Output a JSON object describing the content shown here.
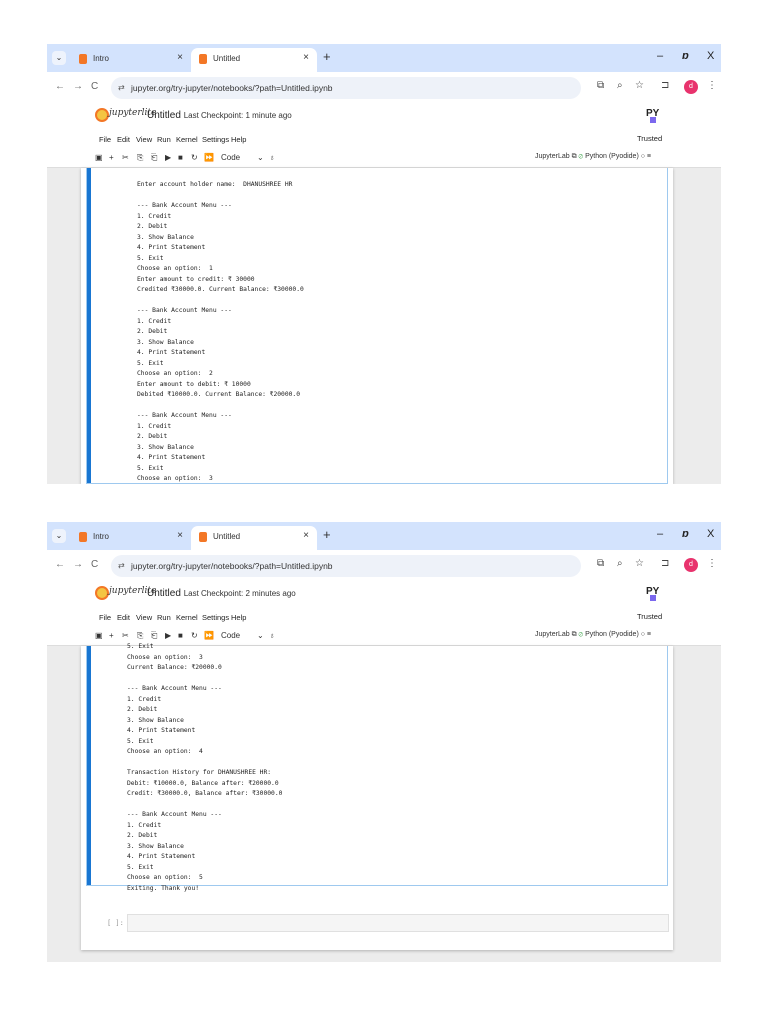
{
  "browser": {
    "tab_intro": "Intro",
    "tab_untitled": "Untitled",
    "url": "jupyter.org/try-jupyter/notebooks/?path=Untitled.ipynb",
    "avatar_letter": "d"
  },
  "jupyter": {
    "logo_text": "jupyterlite",
    "notebook_title": "Untitled",
    "checkpoint_1": "Last Checkpoint: 1 minute ago",
    "checkpoint_2": "Last Checkpoint: 2 minutes ago",
    "menu": [
      "File",
      "Edit",
      "View",
      "Run",
      "Kernel",
      "Settings",
      "Help"
    ],
    "trusted": "Trusted",
    "cell_type": "Code",
    "jupyterlab_link": "JupyterLab",
    "kernel_name": "Python (Pyodide)",
    "empty_prompt": "[ ]:"
  },
  "output_1": "Enter account holder name:  DHANUSHREE HR\n\n--- Bank Account Menu ---\n1. Credit\n2. Debit\n3. Show Balance\n4. Print Statement\n5. Exit\nChoose an option:  1\nEnter amount to credit: ₹ 30000\nCredited ₹30000.0. Current Balance: ₹30000.0\n\n--- Bank Account Menu ---\n1. Credit\n2. Debit\n3. Show Balance\n4. Print Statement\n5. Exit\nChoose an option:  2\nEnter amount to debit: ₹ 10000\nDebited ₹10000.0. Current Balance: ₹20000.0\n\n--- Bank Account Menu ---\n1. Credit\n2. Debit\n3. Show Balance\n4. Print Statement\n5. Exit\nChoose an option:  3\nCurrent Balance: ₹20000.0",
  "output_2": "5. Exit\nChoose an option:  3\nCurrent Balance: ₹20000.0\n\n--- Bank Account Menu ---\n1. Credit\n2. Debit\n3. Show Balance\n4. Print Statement\n5. Exit\nChoose an option:  4\n\nTransaction History for DHANUSHREE HR:\nDebit: ₹10000.0, Balance after: ₹20000.0\nCredit: ₹30000.0, Balance after: ₹30000.0\n\n--- Bank Account Menu ---\n1. Credit\n2. Debit\n3. Show Balance\n4. Print Statement\n5. Exit\nChoose an option:  5\nExiting. Thank you!"
}
